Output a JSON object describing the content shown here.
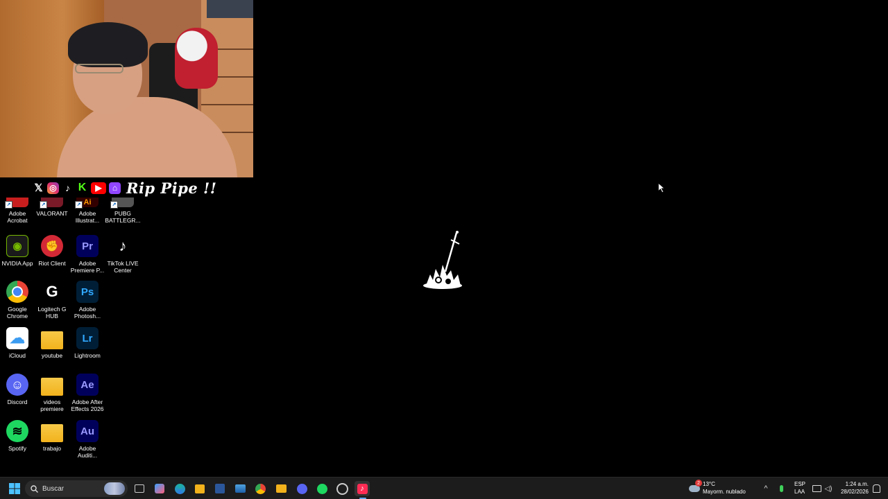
{
  "webcam": {
    "description_hidden": ""
  },
  "social": {
    "icons": [
      "x-icon",
      "instagram-icon",
      "tiktok-icon",
      "kick-icon",
      "youtube-icon",
      "twitch-icon"
    ],
    "x_glyph": "𝕏",
    "ig_glyph": "◎",
    "tt_glyph": "♪",
    "kick_glyph": "K",
    "yt_glyph": "▶",
    "tw_glyph": "⌂",
    "handle": "Rip Pipe !!"
  },
  "desktop": {
    "row0": [
      {
        "label": "Adobe\nAcrobat",
        "icon": "adobe-acrobat-icon",
        "color": "#c81e1e"
      },
      {
        "label": "VALORANT",
        "icon": "valorant-icon",
        "color": "#7a1a28"
      },
      {
        "label": "Adobe\nIllustrat...",
        "icon": "adobe-illustrator-icon",
        "color": "#ff9a00"
      },
      {
        "label": "PUBG\nBATTLEGR...",
        "icon": "pubg-icon",
        "color": "#555555"
      }
    ],
    "row1": [
      {
        "label": "NVIDIA App",
        "icon": "nvidia-icon",
        "color": "#76b900",
        "glyph": "◉"
      },
      {
        "label": "Riot Client",
        "icon": "riot-client-icon",
        "color": "#d32936",
        "glyph": "✊"
      },
      {
        "label": "Adobe\nPremiere P...",
        "icon": "adobe-premiere-icon",
        "color": "#9999ff",
        "glyph": "Pr"
      },
      {
        "label": "TikTok LIVE\nCenter",
        "icon": "tiktok-live-icon",
        "color": "#ffffff",
        "glyph": "♪"
      }
    ],
    "row2": [
      {
        "label": "Google\nChrome",
        "icon": "chrome-icon",
        "glyph": ""
      },
      {
        "label": "Logitech G\nHUB",
        "icon": "logitech-ghub-icon",
        "color": "#ffffff",
        "glyph": "G"
      },
      {
        "label": "Adobe\nPhotosh...",
        "icon": "adobe-photoshop-icon",
        "color": "#31a8ff",
        "glyph": "Ps"
      }
    ],
    "row3": [
      {
        "label": "iCloud",
        "icon": "icloud-icon",
        "glyph": "☁"
      },
      {
        "label": "youtube",
        "icon": "folder-icon",
        "glyph": ""
      },
      {
        "label": "Lightroom",
        "icon": "adobe-lightroom-icon",
        "color": "#31a8ff",
        "glyph": "Lr"
      }
    ],
    "row4": [
      {
        "label": "Discord",
        "icon": "discord-icon",
        "glyph": "☺"
      },
      {
        "label": "videos\npremiere",
        "icon": "folder-icon",
        "glyph": ""
      },
      {
        "label": "Adobe After\nEffects 2026",
        "icon": "adobe-after-effects-icon",
        "color": "#9999ff",
        "glyph": "Ae"
      }
    ],
    "row5": [
      {
        "label": "Spotify",
        "icon": "spotify-icon",
        "glyph": "≋"
      },
      {
        "label": "trabajo",
        "icon": "folder-icon",
        "glyph": ""
      },
      {
        "label": "Adobe\nAuditi...",
        "icon": "adobe-audition-icon",
        "color": "#9999ff",
        "glyph": "Au"
      }
    ]
  },
  "taskbar": {
    "search_placeholder": "Buscar",
    "weather_temp": "13°C",
    "weather_desc": "Mayorm. nublado",
    "weather_badge": "2",
    "lang_top": "ESP",
    "lang_bottom": "LAA",
    "time": "1:24 a.m.",
    "date": "28/02/2026"
  },
  "colors": {
    "taskbar_bg": "#1c1c1c",
    "desktop_bg": "#000000",
    "accent": "#62a8ff"
  }
}
